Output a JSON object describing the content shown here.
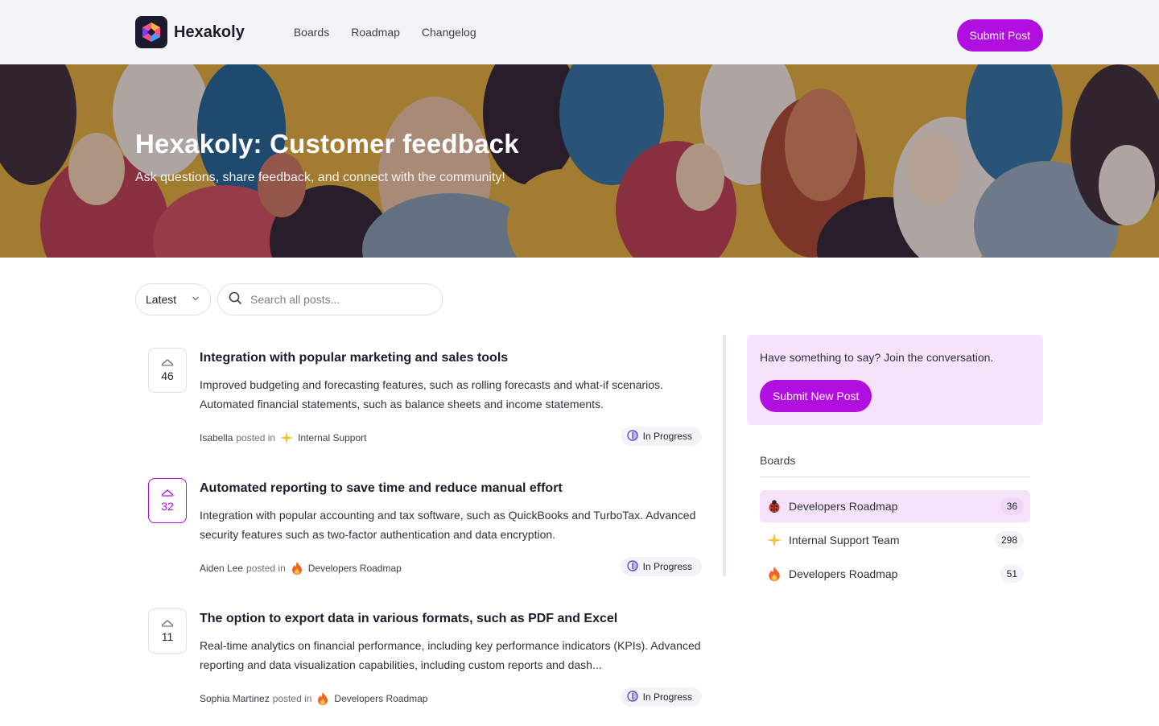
{
  "header": {
    "brand": "Hexakoly",
    "nav": [
      "Boards",
      "Roadmap",
      "Changelog"
    ],
    "submit_label": "Submit Post"
  },
  "hero": {
    "title": "Hexakoly: Customer feedback",
    "subtitle": "Ask questions, share feedback, and connect with the community!"
  },
  "filters": {
    "sort_value": "Latest",
    "search_placeholder": "Search all posts..."
  },
  "posts": [
    {
      "votes": "46",
      "title": "Integration with popular marketing and sales tools",
      "body": "Improved budgeting and forecasting features, such as rolling forecasts and what-if scenarios. Automated financial statements, such as balance sheets and income statements.",
      "author": "Isabella",
      "posted_in": "posted in",
      "board": "Internal Support",
      "board_icon": "sparkle-icon",
      "status": "In Progress"
    },
    {
      "votes": "32",
      "title": "Automated reporting to save time and reduce manual effort",
      "body": "Integration with popular accounting and tax software, such as QuickBooks and TurboTax. Advanced security features such as two-factor authentication and data encryption.",
      "author": "Aiden Lee",
      "posted_in": "posted in",
      "board": "Developers Roadmap",
      "board_icon": "fire-icon",
      "status": "In Progress"
    },
    {
      "votes": "11",
      "title": "The option to export data in various formats, such as PDF and Excel",
      "body": "Real-time analytics on financial performance, including key performance indicators (KPIs). Advanced reporting and data visualization capabilities, including custom reports and dash...",
      "author": "Sophia Martinez",
      "posted_in": "posted in",
      "board": "Developers Roadmap",
      "board_icon": "fire-icon",
      "status": "In Progress"
    }
  ],
  "sidebar": {
    "cta_text": "Have something to say? Join the conversation.",
    "cta_button": "Submit New Post",
    "boards_heading": "Boards",
    "boards": [
      {
        "icon": "ladybug-icon",
        "name": "Developers Roadmap",
        "count": "36"
      },
      {
        "icon": "sparkle-icon",
        "name": "Internal Support Team",
        "count": "298"
      },
      {
        "icon": "fire-icon",
        "name": "Developers Roadmap",
        "count": "51"
      }
    ]
  },
  "colors": {
    "accent": "#b10ee0",
    "accent_light": "#f6e3fb",
    "topbar": "#f3f4f8",
    "status_icon": "#5b4fd6"
  }
}
